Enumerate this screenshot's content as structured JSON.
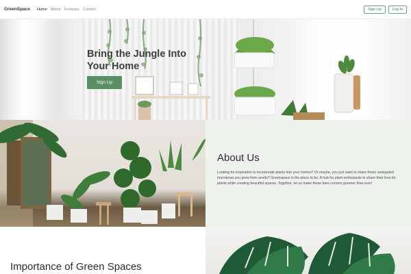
{
  "nav": {
    "brand": "GreenSpace",
    "links": [
      "Home",
      "About",
      "Features",
      "Contact"
    ],
    "signup_label": "Sign Up",
    "login_label": "Log In"
  },
  "hero": {
    "title": "Bring the Jungle Into Your Home",
    "cta_label": "Sign Up"
  },
  "about": {
    "title": "About Us",
    "text": "Looking for inspiration to incorporate plants into your homes? Or maybe, you just want to share those variegated monsteras you grew from seeds? Greenspace is the place to be. A hub for plant enthusiasts to share their love for plants while creating beautiful spaces. Together, let us make those bare corners greener than ever!"
  },
  "importance": {
    "title": "Importance of Green Spaces"
  },
  "colors": {
    "accent": "#5a8f63",
    "about_bg": "#edf2ec"
  }
}
